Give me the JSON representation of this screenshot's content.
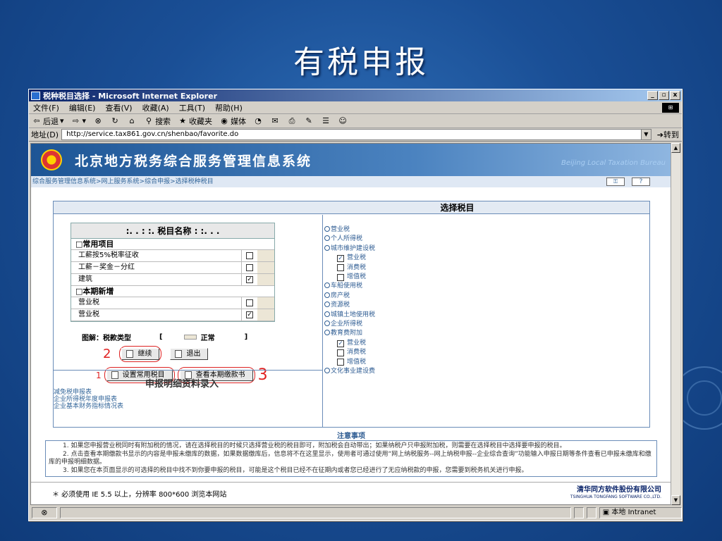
{
  "slide": {
    "title": "有税申报"
  },
  "window": {
    "title": "税种税目选择 - Microsoft Internet Explorer",
    "controls": [
      "_",
      "▫",
      "x"
    ],
    "menu": [
      "文件(F)",
      "编辑(E)",
      "查看(V)",
      "收藏(A)",
      "工具(T)",
      "帮助(H)"
    ],
    "toolbar": {
      "back": "后退",
      "search": "搜索",
      "favorites": "收藏夹",
      "media": "媒体"
    },
    "address_label": "地址(D)",
    "address": "http://service.tax861.gov.cn/shenbao/favorite.do",
    "go": "转到"
  },
  "site": {
    "system_name": "北京地方税务综合服务管理信息系统",
    "english_name": "Beijing Local Taxation Bureau",
    "breadcrumb": "综合服务管理信息系统>网上服务系统>综合申报>选择税种税目",
    "help": "?"
  },
  "panel": {
    "title": "选择税目",
    "left_header": ":. . : :. 税目名称 : :. . .",
    "common_section": "□常用项目",
    "common_items": [
      {
        "name": "工薪按5%税率征收",
        "checked": false
      },
      {
        "name": "工薪－奖金－分红",
        "checked": false
      },
      {
        "name": "建筑",
        "checked": true
      }
    ],
    "new_section": "□本期新增",
    "new_items": [
      {
        "name": "营业税",
        "checked": false
      },
      {
        "name": "营业税",
        "checked": true
      }
    ],
    "legend_label": "图解：税款类型",
    "legend_bracket_left": "[",
    "legend_normal": "正常",
    "legend_bracket_right": "]",
    "continue_btn": "继续",
    "exit_btn": "退出",
    "set_common_btn": "设置常用税目",
    "view_books_btn": "查看本期缴款书",
    "annotations": [
      "2",
      "1",
      "3"
    ],
    "detail_title": "申报明细资料录入",
    "detail_links": [
      "减免税申报表",
      "企业所得税年度申报表",
      "企业基本财务指标情况表"
    ],
    "tree": [
      {
        "level": 1,
        "label": "营业税"
      },
      {
        "level": 1,
        "label": "个人所得税"
      },
      {
        "level": 1,
        "label": "城市维护建设税"
      },
      {
        "level": 2,
        "label": "营业税",
        "checked": true
      },
      {
        "level": 2,
        "label": "消费税",
        "checked": false
      },
      {
        "level": 2,
        "label": "增值税",
        "checked": false
      },
      {
        "level": 1,
        "label": "车船使用税"
      },
      {
        "level": 1,
        "label": "房产税"
      },
      {
        "level": 1,
        "label": "资源税"
      },
      {
        "level": 1,
        "label": "城镇土地使用税"
      },
      {
        "level": 1,
        "label": "企业所得税"
      },
      {
        "level": 1,
        "label": "教育费附加"
      },
      {
        "level": 2,
        "label": "营业税",
        "checked": true
      },
      {
        "level": 2,
        "label": "消费税",
        "checked": false
      },
      {
        "level": 2,
        "label": "增值税",
        "checked": false
      },
      {
        "level": 1,
        "label": "文化事业建设费"
      }
    ]
  },
  "notes": {
    "title": "注意事项",
    "items": [
      "1. 如果您申报营业税同时有附加税的情况，请在选择税目的时候只选择营业税的税目即可，附加税会自动带出；如果纳税户只申报附加税，则需要在选择税目中选择要申报的税目。",
      "2. 点击查看本期缴款书显示的内容是申报未缴库的数据，如果数据缴库后，信息将不在这里显示，使用者可通过使用“网上纳税服务--网上纳税申报--企业综合查询”功能输入申报日期等条件查看已申报未缴库和缴库的申报明细数据。",
      "3. 如果您在本页面显示的可选择的税目中找不到你要申报的税目，可能是这个税目已经不在征期内或者您已经进行了无应纳税款的申报，您需要到税务机关进行申报。"
    ]
  },
  "footer": {
    "requirement": "＊ 必须使用 IE 5.5 以上，分辨率 800*600 浏览本网站",
    "company": "清华同方软件股份有限公司",
    "company_en": "TSINGHUA TONGFANG SOFTWARE CO.,LTD."
  },
  "status": {
    "zone": "本地 Intranet"
  }
}
